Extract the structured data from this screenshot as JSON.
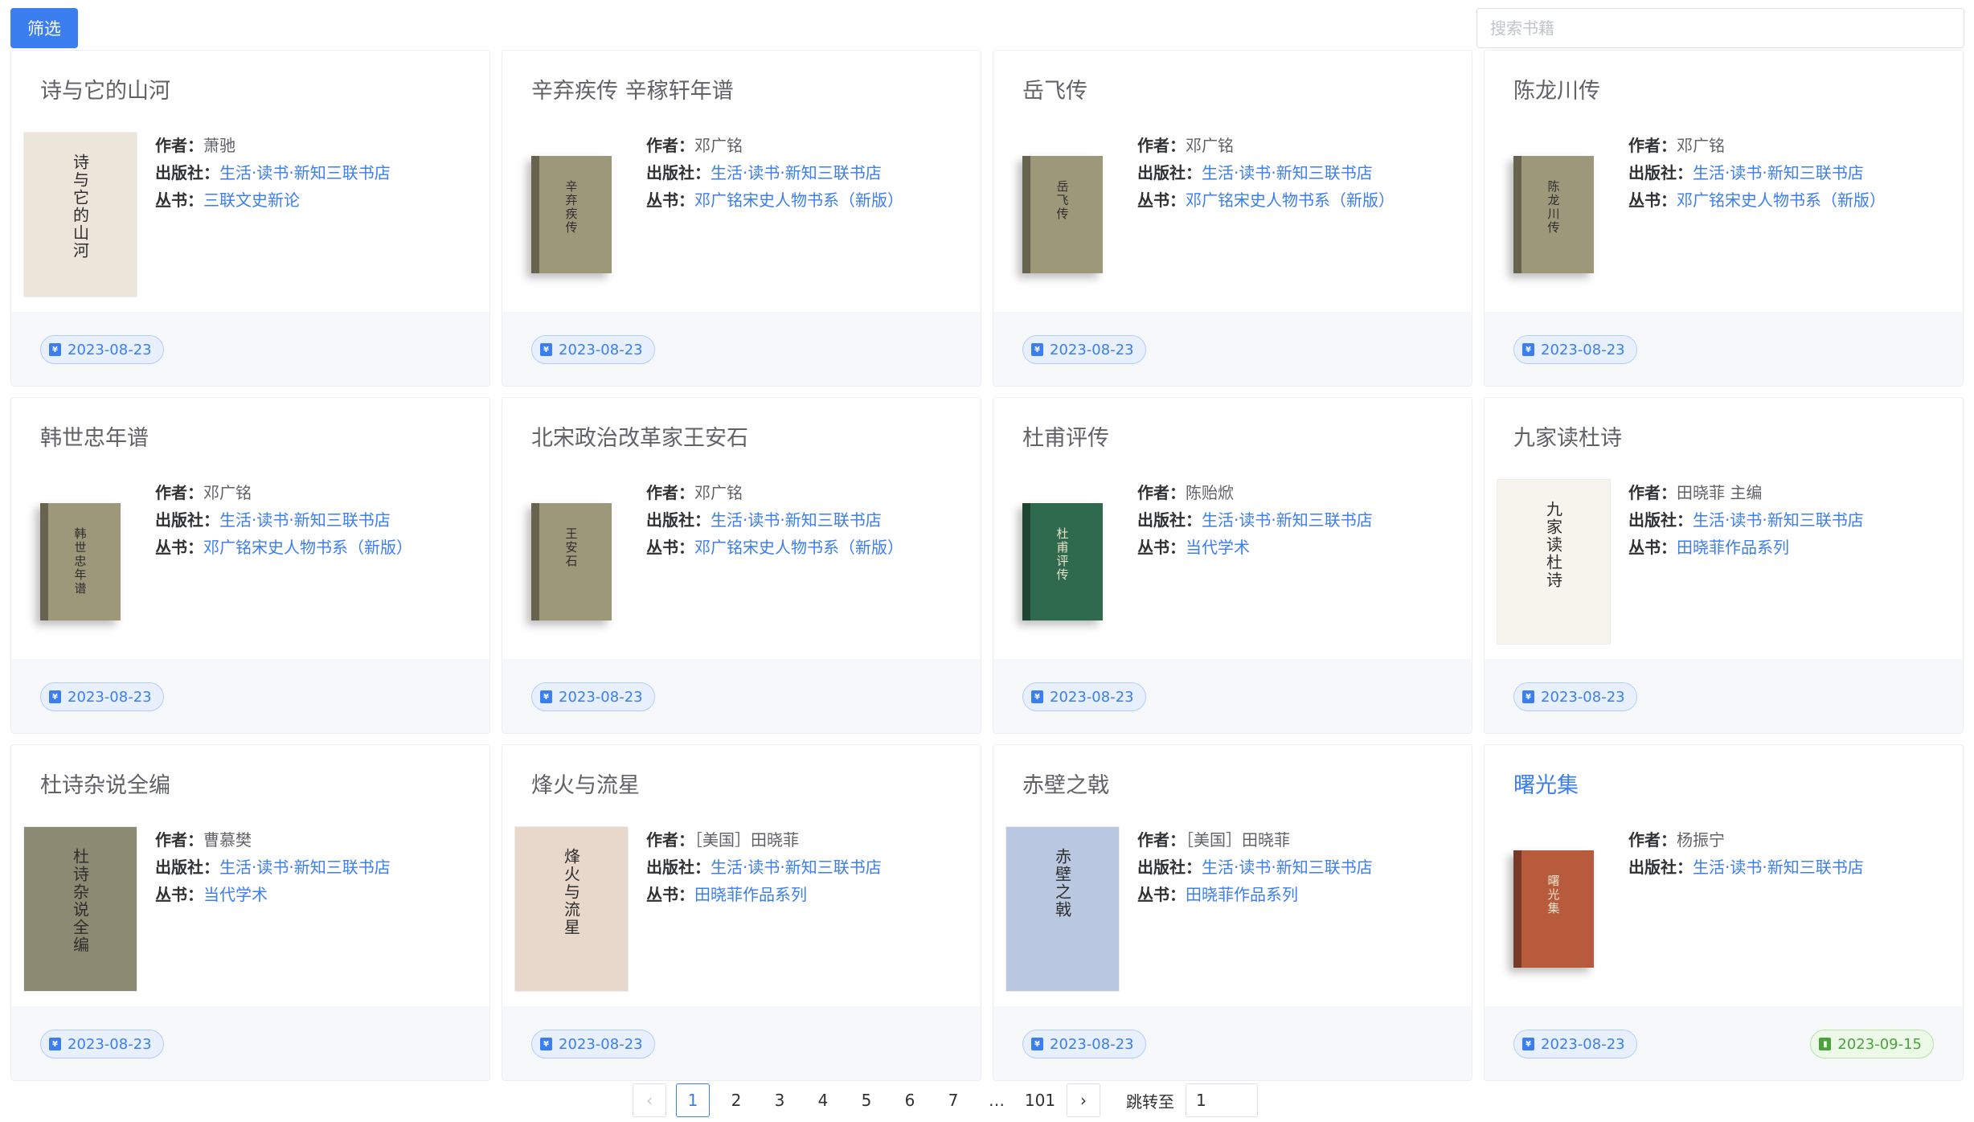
{
  "toolbar": {
    "filter_label": "筛选"
  },
  "search": {
    "placeholder": "搜索书籍"
  },
  "labels": {
    "author": "作者：",
    "publisher": "出版社：",
    "series": "丛书："
  },
  "books": [
    {
      "title": "诗与它的山河",
      "author": "萧驰",
      "publisher": "生活·读书·新知三联书店",
      "series": "三联文史新论",
      "date": "2023-08-23",
      "cover_title": "诗与它的山河",
      "cover_color": "#ece6da",
      "cover_style": "flat"
    },
    {
      "title": "辛弃疾传 辛稼轩年谱",
      "author": "邓广铭",
      "publisher": "生活·读书·新知三联书店",
      "series": "邓广铭宋史人物书系（新版）",
      "date": "2023-08-23",
      "cover_title": "辛弃疾传",
      "cover_color": "#9e987a",
      "cover_style": "book"
    },
    {
      "title": "岳飞传",
      "author": "邓广铭",
      "publisher": "生活·读书·新知三联书店",
      "series": "邓广铭宋史人物书系（新版）",
      "date": "2023-08-23",
      "cover_title": "岳飞传",
      "cover_color": "#9e987a",
      "cover_style": "book"
    },
    {
      "title": "陈龙川传",
      "author": "邓广铭",
      "publisher": "生活·读书·新知三联书店",
      "series": "邓广铭宋史人物书系（新版）",
      "date": "2023-08-23",
      "cover_title": "陈龙川传",
      "cover_color": "#9e987a",
      "cover_style": "book"
    },
    {
      "title": "韩世忠年谱",
      "author": "邓广铭",
      "publisher": "生活·读书·新知三联书店",
      "series": "邓广铭宋史人物书系（新版）",
      "date": "2023-08-23",
      "cover_title": "韩世忠年谱",
      "cover_color": "#9e987a",
      "cover_style": "book"
    },
    {
      "title": "北宋政治改革家王安石",
      "author": "邓广铭",
      "publisher": "生活·读书·新知三联书店",
      "series": "邓广铭宋史人物书系（新版）",
      "date": "2023-08-23",
      "cover_title": "王安石",
      "cover_color": "#9e987a",
      "cover_style": "book"
    },
    {
      "title": "杜甫评传",
      "author": "陈贻焮",
      "publisher": "生活·读书·新知三联书店",
      "series": "当代学术",
      "date": "2023-08-23",
      "cover_title": "杜甫评传",
      "cover_color": "#2f6a4e",
      "cover_style": "book"
    },
    {
      "title": "九家读杜诗",
      "author": "田晓菲 主编",
      "publisher": "生活·读书·新知三联书店",
      "series": "田晓菲作品系列",
      "date": "2023-08-23",
      "cover_title": "九家读杜诗",
      "cover_color": "#f7f4ee",
      "cover_style": "flat"
    },
    {
      "title": "杜诗杂说全编",
      "author": "曹慕樊",
      "publisher": "生活·读书·新知三联书店",
      "series": "当代学术",
      "date": "2023-08-23",
      "cover_title": "杜诗杂说全编",
      "cover_color": "#8c8a72",
      "cover_style": "flat"
    },
    {
      "title": "烽火与流星",
      "author": "［美国］田晓菲",
      "publisher": "生活·读书·新知三联书店",
      "series": "田晓菲作品系列",
      "date": "2023-08-23",
      "cover_title": "烽火与流星",
      "cover_color": "#e8d8cc",
      "cover_style": "flat"
    },
    {
      "title": "赤壁之戟",
      "author": "［美国］田晓菲",
      "publisher": "生活·读书·新知三联书店",
      "series": "田晓菲作品系列",
      "date": "2023-08-23",
      "cover_title": "赤壁之戟",
      "cover_color": "#b9c8e0",
      "cover_style": "flat"
    },
    {
      "title": "曙光集",
      "author": "杨振宁",
      "publisher": "生活·读书·新知三联书店",
      "date": "2023-08-23",
      "date2": "2023-09-15",
      "cover_title": "曙光集",
      "cover_color": "#b85a3c",
      "cover_style": "book"
    }
  ],
  "pagination": {
    "pages": [
      "1",
      "2",
      "3",
      "4",
      "5",
      "6",
      "7",
      "…",
      "101"
    ],
    "current": "1",
    "prev": "‹",
    "next": "›",
    "jump_label": "跳转至",
    "jump_value": "1"
  },
  "icons": {
    "date_tag": "calendar-icon",
    "date2_tag": "stack-icon"
  },
  "colors": {
    "accent": "#3b7ef0",
    "green": "#4aa43a"
  }
}
